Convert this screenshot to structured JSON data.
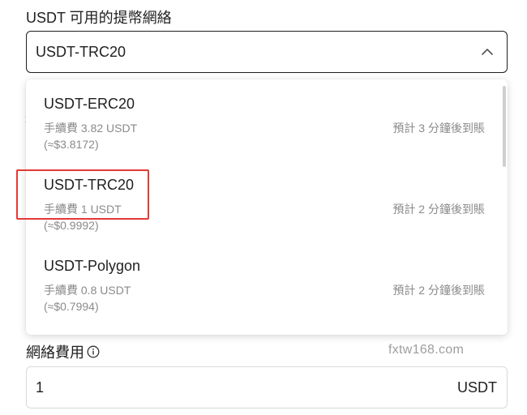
{
  "form": {
    "network_label": "USDT 可用的提幣網絡",
    "selected_network": "USDT-TRC20",
    "fee_label": "網絡費用",
    "fee_value": "1",
    "fee_unit": "USDT"
  },
  "dropdown": {
    "options": [
      {
        "name": "USDT-ERC20",
        "fee": "手續費 3.82 USDT",
        "usd": "(≈$3.8172)",
        "eta": "預計 3 分鐘後到賬"
      },
      {
        "name": "USDT-TRC20",
        "fee": "手續費 1 USDT",
        "usd": "(≈$0.9992)",
        "eta": "預計 2 分鐘後到賬"
      },
      {
        "name": "USDT-Polygon",
        "fee": "手續費 0.8 USDT",
        "usd": "(≈$0.7994)",
        "eta": "預計 2 分鐘後到賬"
      }
    ]
  },
  "watermark": "fxtw168.com",
  "icons": {
    "select_toggle": "chevron-up-icon",
    "fee_info": "info-icon"
  },
  "colors": {
    "highlight": "#e53935",
    "secondary_text": "#8a8a8a"
  }
}
